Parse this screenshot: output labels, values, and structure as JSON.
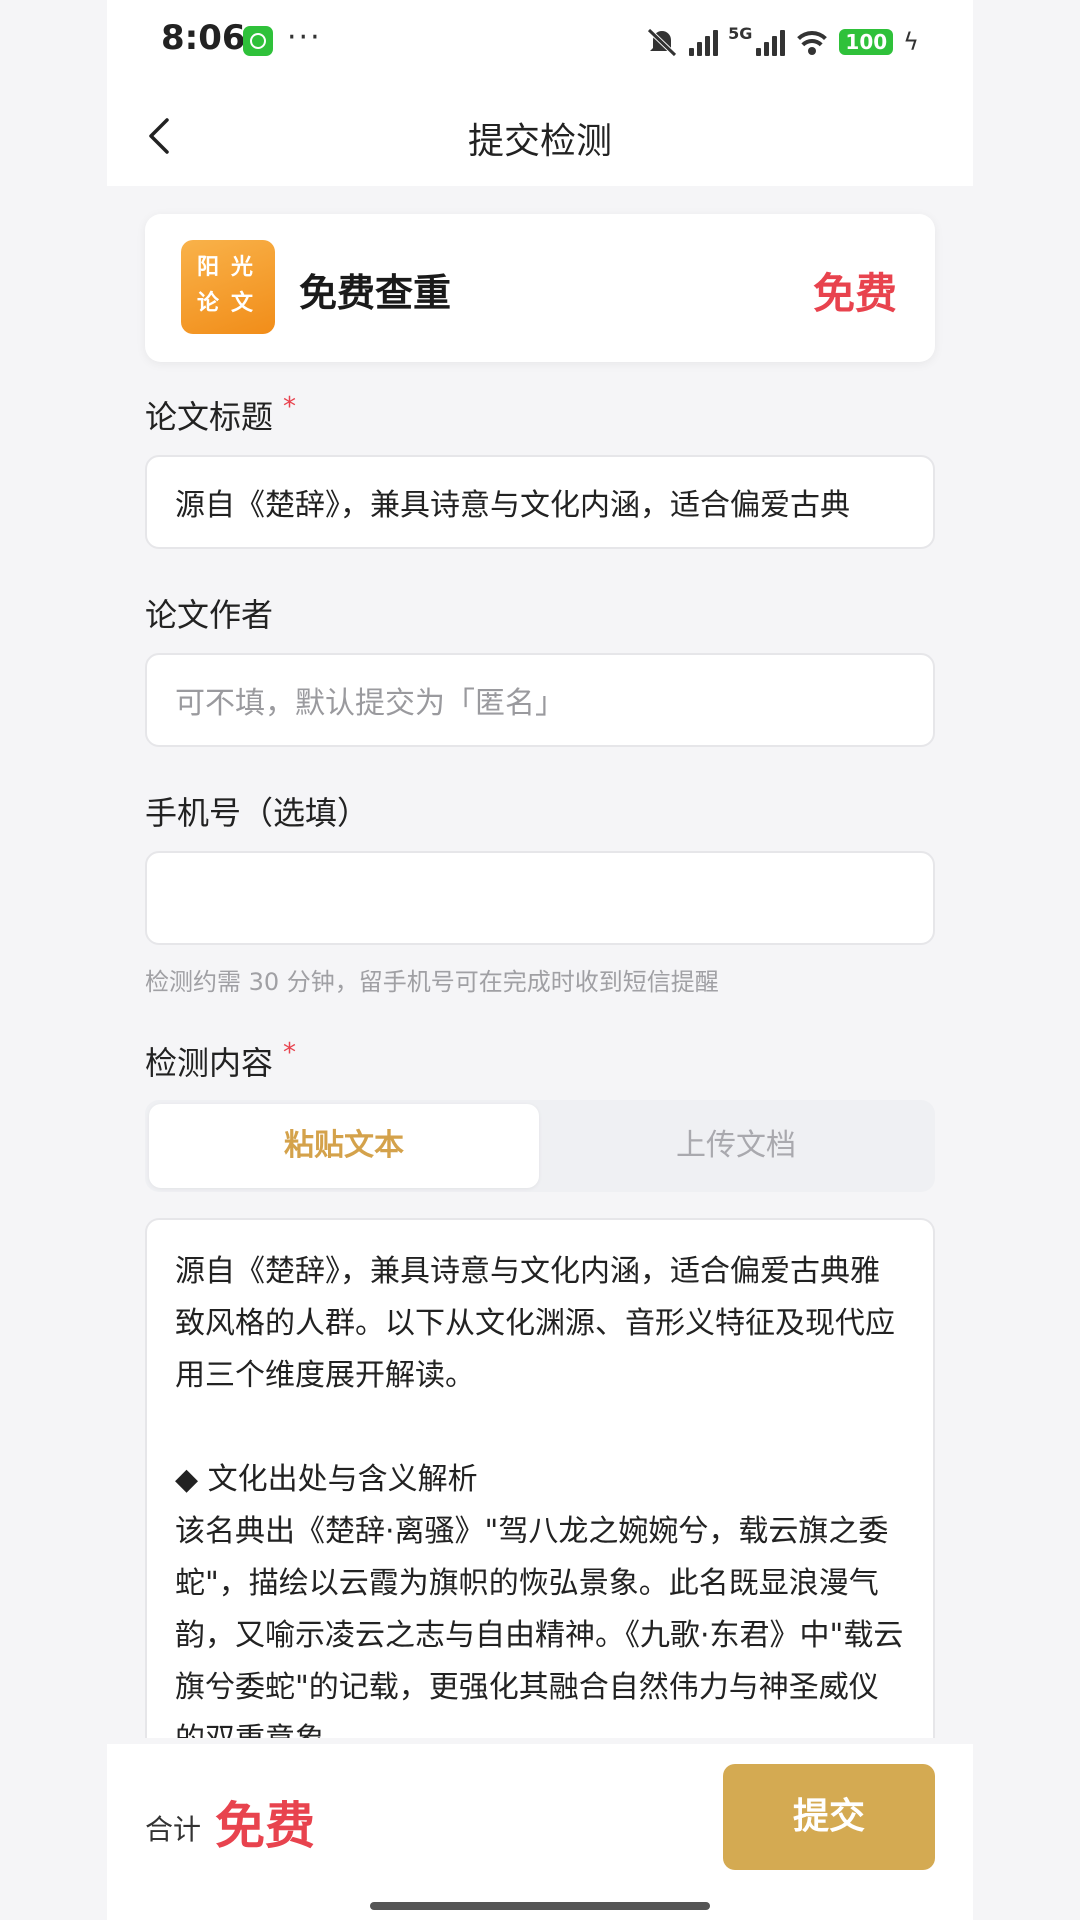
{
  "status": {
    "time": "8:06",
    "dots": "···",
    "network": "5G",
    "battery": "100"
  },
  "nav": {
    "title": "提交检测"
  },
  "service": {
    "logo_line1": "阳光",
    "logo_line2": "论文",
    "name": "免费查重",
    "price": "免费"
  },
  "form": {
    "title_label": "论文标题",
    "required_mark": "*",
    "title_value": "源自《楚辞》，兼具诗意与文化内涵，适合偏爱古典",
    "author_label": "论文作者",
    "author_placeholder": "可不填，默认提交为「匿名」",
    "phone_label": "手机号（选填）",
    "phone_value": "",
    "phone_hint": "检测约需 30 分钟，留手机号可在完成时收到短信提醒",
    "content_label": "检测内容",
    "tabs": [
      {
        "label": "粘贴文本",
        "active": true
      },
      {
        "label": "上传文档",
        "active": false
      }
    ],
    "content_paragraphs": [
      "源自《楚辞》，兼具诗意与文化内涵，适合偏爱古典雅致风格的人群。以下从文化渊源、音形义特征及现代应用三个维度展开解读。",
      "◆ 文化出处与含义解析",
      "该名典出《楚辞·离骚》\"驾八龙之婉婉兮，载云旗之委蛇\"，描绘以云霞为旗帜的恢弘景象。此名既显浪漫气韵，又喻示凌云之志与自由精神。《九歌·东君》中\"载云旗兮委蛇\"的记载，更强化其融合自然伟力与神圣威仪的双重意象。"
    ]
  },
  "footer": {
    "total_label": "合计",
    "total_value": "免费",
    "submit_label": "提交"
  },
  "colors": {
    "accent_gold": "#d4aa52",
    "price_red": "#e8434e",
    "logo_orange": "#f18d19"
  }
}
